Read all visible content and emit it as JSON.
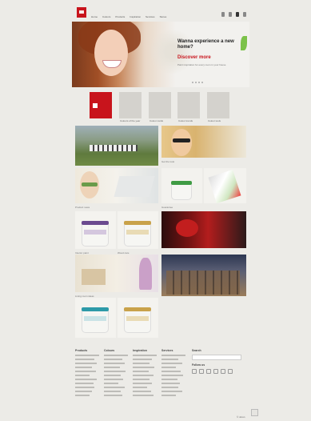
{
  "header": {
    "nav": [
      "Home",
      "Colours",
      "Products",
      "Inspiration",
      "Services",
      "Stores"
    ]
  },
  "hero": {
    "headline": "Wanna experience a new home?",
    "cta": "Discover more",
    "body": "Paint inspiration for every room in your house"
  },
  "tiles": [
    {
      "label": ""
    },
    {
      "label": "Colours of the year"
    },
    {
      "label": "Colour cards"
    },
    {
      "label": "Colour trends"
    },
    {
      "label": "Colour tools"
    }
  ],
  "captions": {
    "landscape": "Colour inspiration",
    "lady_glasses": "Get the look",
    "glasses": "Product news",
    "paint_green": "Guarantee",
    "tub_purple": "Interior paint",
    "tub_gold": "Wood care",
    "red_bottle": "Campaign",
    "room": "Living room ideas",
    "girl": "Kids room",
    "city": "Exterior ideas",
    "tub_teal": "Wall paint",
    "tub_gold2": "Floor paint"
  },
  "footer": {
    "col1": "Products",
    "col2": "Colours",
    "col3": "Inspiration",
    "col4": "Services",
    "col5": "Search",
    "social": "Follow us",
    "copyright": "© Jotun"
  },
  "colors": {
    "brand": "#c8141c",
    "bg": "#ecebe7"
  }
}
